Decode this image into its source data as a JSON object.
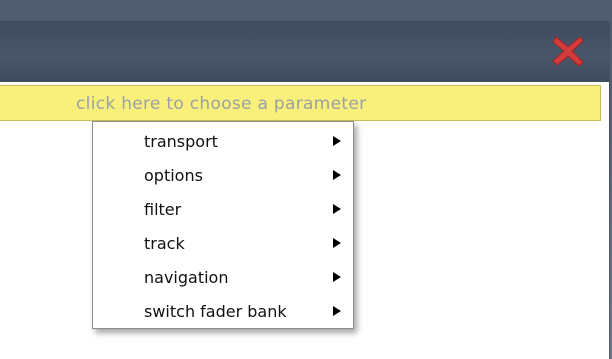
{
  "param_bar": {
    "placeholder": "click here to choose a parameter"
  },
  "close_icon_color": "#d43b3b",
  "param_bar_color": "#f9f07b",
  "menu": {
    "items": [
      {
        "label": "transport",
        "icon": "chevron-right-icon"
      },
      {
        "label": "options",
        "icon": "chevron-right-icon"
      },
      {
        "label": "filter",
        "icon": "chevron-right-icon"
      },
      {
        "label": "track",
        "icon": "chevron-right-icon"
      },
      {
        "label": "navigation",
        "icon": "chevron-right-icon"
      },
      {
        "label": "switch fader bank",
        "icon": "chevron-right-icon"
      }
    ]
  }
}
